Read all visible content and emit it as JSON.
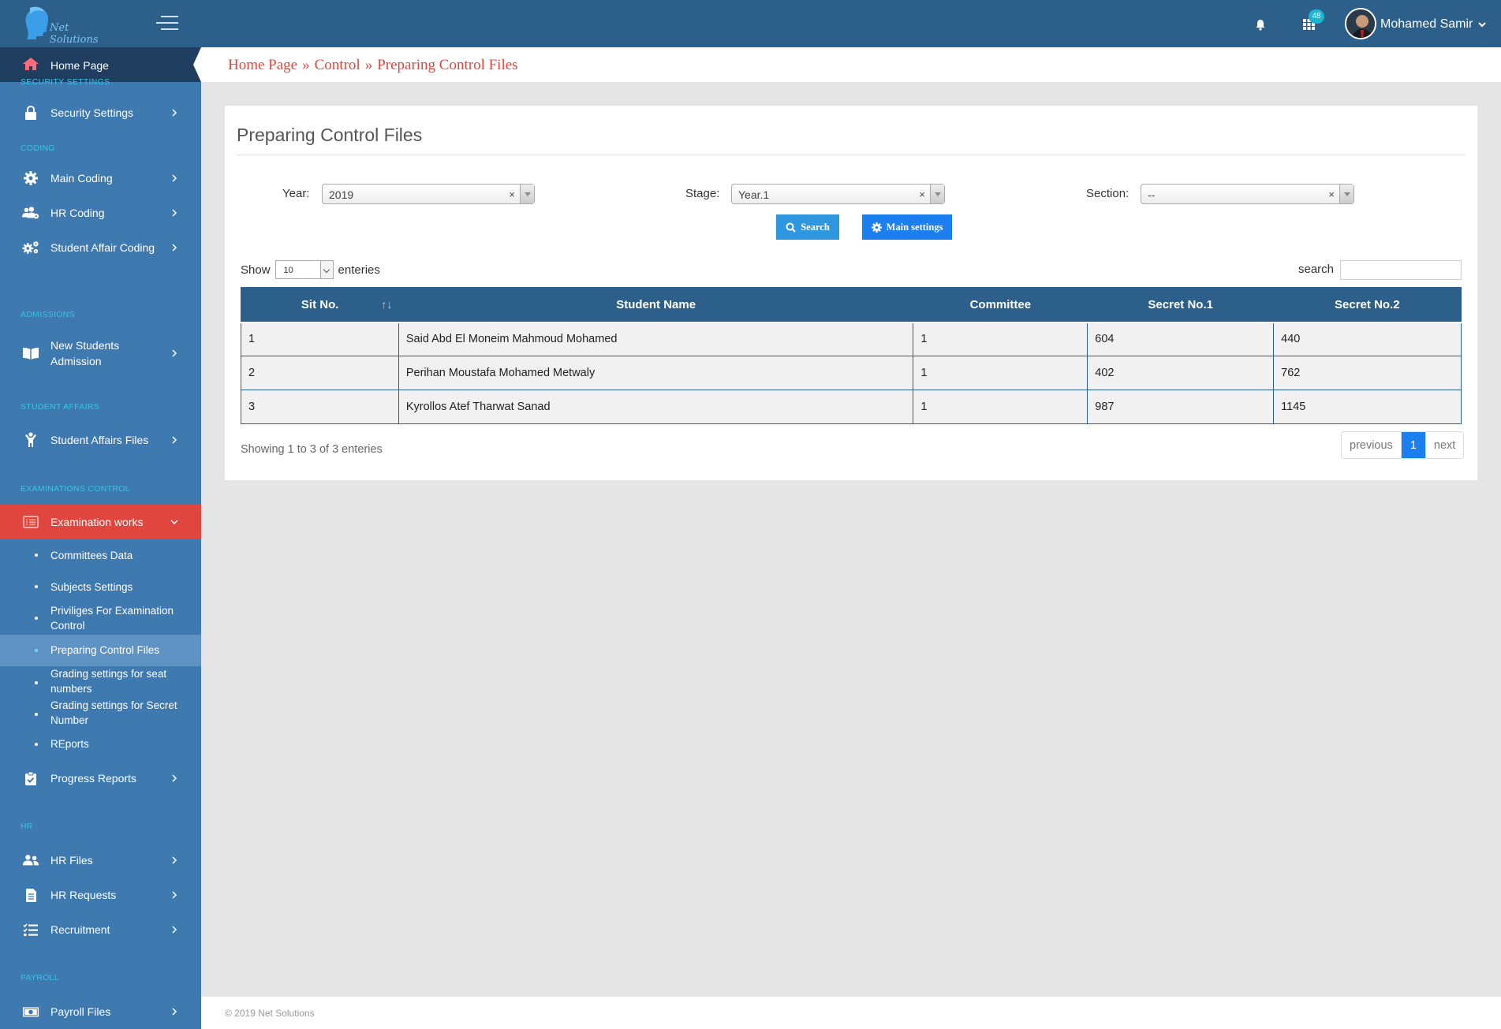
{
  "app": {
    "logo_text": "Net Solutions",
    "notifications_badge": "48",
    "user_name": "Mohamed Samir"
  },
  "colors": {
    "topbar": "#2d5f8b",
    "sidebar": "#3e79b0",
    "active_item": "#e0463e",
    "accent": "#1b7ff0"
  },
  "breadcrumb": {
    "items": [
      "Home Page",
      "Control",
      "Preparing Control Files"
    ],
    "separator": "»"
  },
  "sidebar": {
    "home": "Home Page",
    "sections": {
      "security": "SECURITY SETTINGS",
      "coding": "CODING",
      "admissions": "ADMISSIONS",
      "student_affairs": "STUDENT AFFAIRS",
      "exam_control": "EXAMINATIONS CONTROL",
      "hr": "HR",
      "payroll": "PAYROLL"
    },
    "items": {
      "security_settings": "Security Settings",
      "main_coding": "Main Coding",
      "hr_coding": "HR Coding",
      "student_affair_coding": "Student Affair Coding",
      "new_students_admission_1": "New Students",
      "new_students_admission_2": "Admission",
      "student_affairs_files": "Student Affairs Files",
      "examination_works": "Examination works",
      "progress_reports": "Progress Reports",
      "hr_files": "HR Files",
      "hr_requests": "HR Requests",
      "recruitment": "Recruitment",
      "payroll_files": "Payroll Files"
    },
    "sub_items": {
      "committees_data": "Committees Data",
      "subjects_settings": "Subjects Settings",
      "priviliges_1": "Priviliges For Examination",
      "priviliges_2": "Control",
      "preparing_control_files": "Preparing Control Files",
      "grading_seat_1": "Grading settings for seat",
      "grading_seat_2": "numbers",
      "grading_secret_1": "Grading settings for Secret",
      "grading_secret_2": "Number",
      "reports": "REports"
    }
  },
  "page": {
    "title": "Preparing Control Files",
    "filters": {
      "year_label": "Year:",
      "year_value": "2019",
      "stage_label": "Stage:",
      "stage_value": "Year.1",
      "section_label": "Section:",
      "section_value": "--",
      "clear_glyph": "×"
    },
    "buttons": {
      "search": "Search",
      "main_settings": "Main settings"
    },
    "table_controls": {
      "show_label": "Show",
      "length_value": "10",
      "entries_label": "enteries",
      "search_label": "search"
    },
    "table": {
      "headers": [
        "Sit No.",
        "Student Name",
        "Committee",
        "Secret No.1",
        "Secret No.2"
      ],
      "rows": [
        [
          "1",
          "Said Abd El Moneim Mahmoud Mohamed",
          "1",
          "604",
          "440"
        ],
        [
          "2",
          "Perihan Moustafa Mohamed Metwaly",
          "1",
          "402",
          "762"
        ],
        [
          "3",
          "Kyrollos Atef Tharwat Sanad",
          "1",
          "987",
          "1145"
        ]
      ]
    },
    "info": "Showing 1 to 3 of 3 enteries",
    "pagination": {
      "previous": "previous",
      "current": "1",
      "next": "next"
    }
  },
  "footer": {
    "copyright": "© 2019 Net Solutions"
  }
}
